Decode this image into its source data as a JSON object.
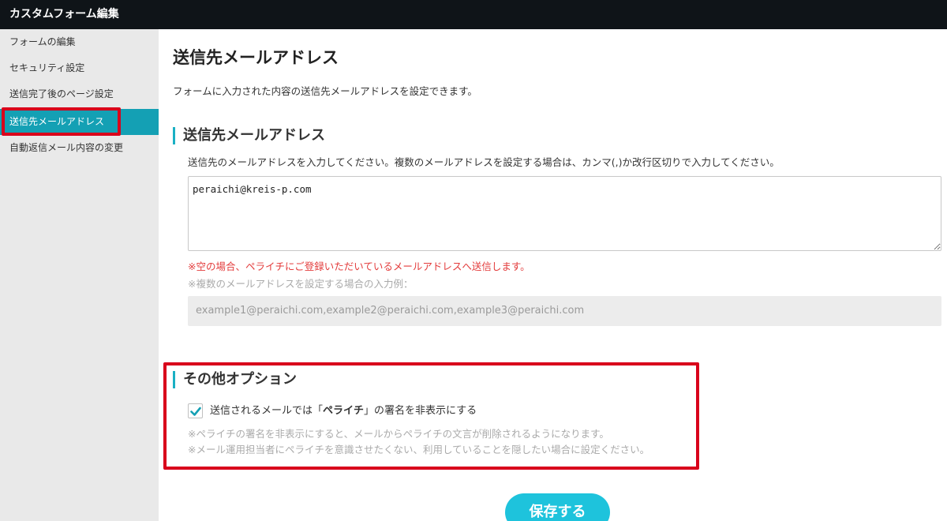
{
  "app": {
    "title": "カスタムフォーム編集"
  },
  "sidebar": {
    "items": [
      {
        "label": "フォームの編集",
        "active": false
      },
      {
        "label": "セキュリティ設定",
        "active": false
      },
      {
        "label": "送信完了後のページ設定",
        "active": false
      },
      {
        "label": "送信先メールアドレス",
        "active": true
      },
      {
        "label": "自動返信メール内容の変更",
        "active": false
      }
    ]
  },
  "page": {
    "title": "送信先メールアドレス",
    "description": "フォームに入力された内容の送信先メールアドレスを設定できます。"
  },
  "email_section": {
    "heading": "送信先メールアドレス",
    "hint": "送信先のメールアドレスを入力してください。複数のメールアドレスを設定する場合は、カンマ(,)か改行区切りで入力してください。",
    "value": "peraichi@kreis-p.com",
    "warning": "※空の場合、ペライチにご登録いただいているメールアドレスへ送信します。",
    "example_label": "※複数のメールアドレスを設定する場合の入力例：",
    "example_value": "example1@peraichi.com,example2@peraichi.com,example3@peraichi.com"
  },
  "options_section": {
    "heading": "その他オプション",
    "checkbox": {
      "checked": true,
      "label_before": "送信されるメールでは「",
      "label_bold": "ペライチ",
      "label_after": "」の署名を非表示にする"
    },
    "note_1": "※ペライチの署名を非表示にすると、メールからペライチの文言が削除されるようになります。",
    "note_2": "※メール運用担当者にペライチを意識させたくない、利用していることを隠したい場合に設定ください。"
  },
  "actions": {
    "save_label": "保存する"
  },
  "colors": {
    "accent": "#14a0b4",
    "save_button": "#1ec3dc",
    "highlight_outline": "#d9001b",
    "warning_text": "#e33b3b",
    "topbar": "#0f1418"
  }
}
